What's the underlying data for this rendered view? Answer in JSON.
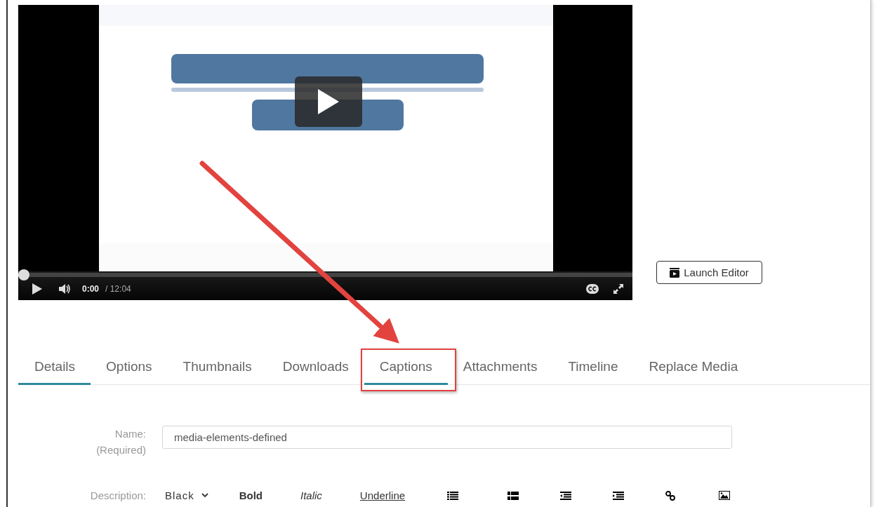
{
  "video": {
    "kind": "picture",
    "progress": {
      "level": 0
    },
    "time_current": "0:00",
    "time_total": "/ 12:04"
  },
  "launch_button": {
    "label": "Launch Editor"
  },
  "tabs": [
    {
      "label": "Details",
      "selected": true,
      "annotated": false
    },
    {
      "label": "Options",
      "selected": false,
      "annotated": false
    },
    {
      "label": "Thumbnails",
      "selected": false,
      "annotated": false
    },
    {
      "label": "Downloads",
      "selected": false,
      "annotated": false
    },
    {
      "label": "Captions",
      "selected": true,
      "annotated": true
    },
    {
      "label": "Attachments",
      "selected": false,
      "annotated": false
    },
    {
      "label": "Timeline",
      "selected": false,
      "annotated": false
    },
    {
      "label": "Replace Media",
      "selected": false,
      "annotated": false
    }
  ],
  "form": {
    "name": {
      "label": "Name:",
      "hint": "(Required)",
      "value": "media-elements-defined"
    },
    "description": {
      "label": "Description:",
      "toolbar": [
        {
          "kind": "dropdown",
          "label": "Black"
        },
        {
          "kind": "bold",
          "label": "Bold"
        },
        {
          "kind": "italic",
          "label": "Italic"
        },
        {
          "kind": "underline",
          "label": "Underline"
        }
      ]
    }
  }
}
